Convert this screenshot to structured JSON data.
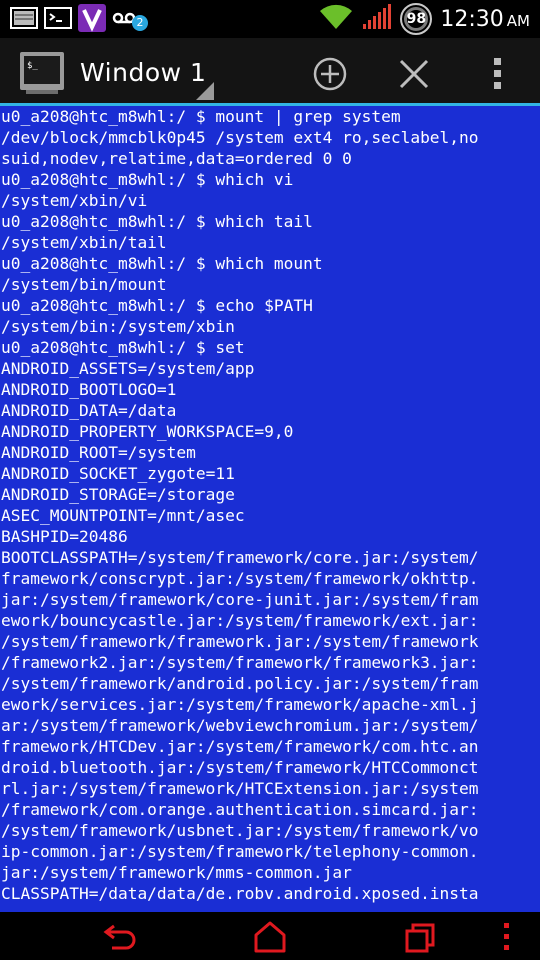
{
  "status_bar": {
    "time": "12:30",
    "ampm": "AM",
    "battery_level": "98",
    "notification_count": "2",
    "icons": [
      "picture-icon",
      "terminal-icon",
      "v-app-icon",
      "voicemail-icon",
      "wifi-icon",
      "signal-icon"
    ]
  },
  "action_bar": {
    "window_title": "Window 1",
    "icons": [
      "terminal-app-icon",
      "add-window-icon",
      "close-window-icon",
      "overflow-menu-icon"
    ]
  },
  "terminal": {
    "lines": [
      "u0_a208@htc_m8whl:/ $ mount | grep system",
      "/dev/block/mmcblk0p45 /system ext4 ro,seclabel,no",
      "suid,nodev,relatime,data=ordered 0 0",
      "u0_a208@htc_m8whl:/ $ which vi",
      "/system/xbin/vi",
      "u0_a208@htc_m8whl:/ $ which tail",
      "/system/xbin/tail",
      "u0_a208@htc_m8whl:/ $ which mount",
      "/system/bin/mount",
      "u0_a208@htc_m8whl:/ $ echo $PATH",
      "/system/bin:/system/xbin",
      "u0_a208@htc_m8whl:/ $ set",
      "ANDROID_ASSETS=/system/app",
      "ANDROID_BOOTLOGO=1",
      "ANDROID_DATA=/data",
      "ANDROID_PROPERTY_WORKSPACE=9,0",
      "ANDROID_ROOT=/system",
      "ANDROID_SOCKET_zygote=11",
      "ANDROID_STORAGE=/storage",
      "ASEC_MOUNTPOINT=/mnt/asec",
      "BASHPID=20486",
      "BOOTCLASSPATH=/system/framework/core.jar:/system/",
      "framework/conscrypt.jar:/system/framework/okhttp.",
      "jar:/system/framework/core-junit.jar:/system/fram",
      "ework/bouncycastle.jar:/system/framework/ext.jar:",
      "/system/framework/framework.jar:/system/framework",
      "/framework2.jar:/system/framework/framework3.jar:",
      "/system/framework/android.policy.jar:/system/fram",
      "ework/services.jar:/system/framework/apache-xml.j",
      "ar:/system/framework/webviewchromium.jar:/system/",
      "framework/HTCDev.jar:/system/framework/com.htc.an",
      "droid.bluetooth.jar:/system/framework/HTCCommonct",
      "rl.jar:/system/framework/HTCExtension.jar:/system",
      "/framework/com.orange.authentication.simcard.jar:",
      "/system/framework/usbnet.jar:/system/framework/vo",
      "ip-common.jar:/system/framework/telephony-common.",
      "jar:/system/framework/mms-common.jar",
      "CLASSPATH=/data/data/de.robv.android.xposed.insta"
    ]
  },
  "nav_bar": {
    "icons": [
      "back-icon",
      "home-icon",
      "recent-apps-icon",
      "menu-icon"
    ],
    "accent_color": "#e0191f"
  },
  "colors": {
    "terminal_background": "#1a2ed4",
    "terminal_text": "#ffffff",
    "action_bar_underline": "#33b5e5",
    "status_bar_background": "#000000"
  }
}
